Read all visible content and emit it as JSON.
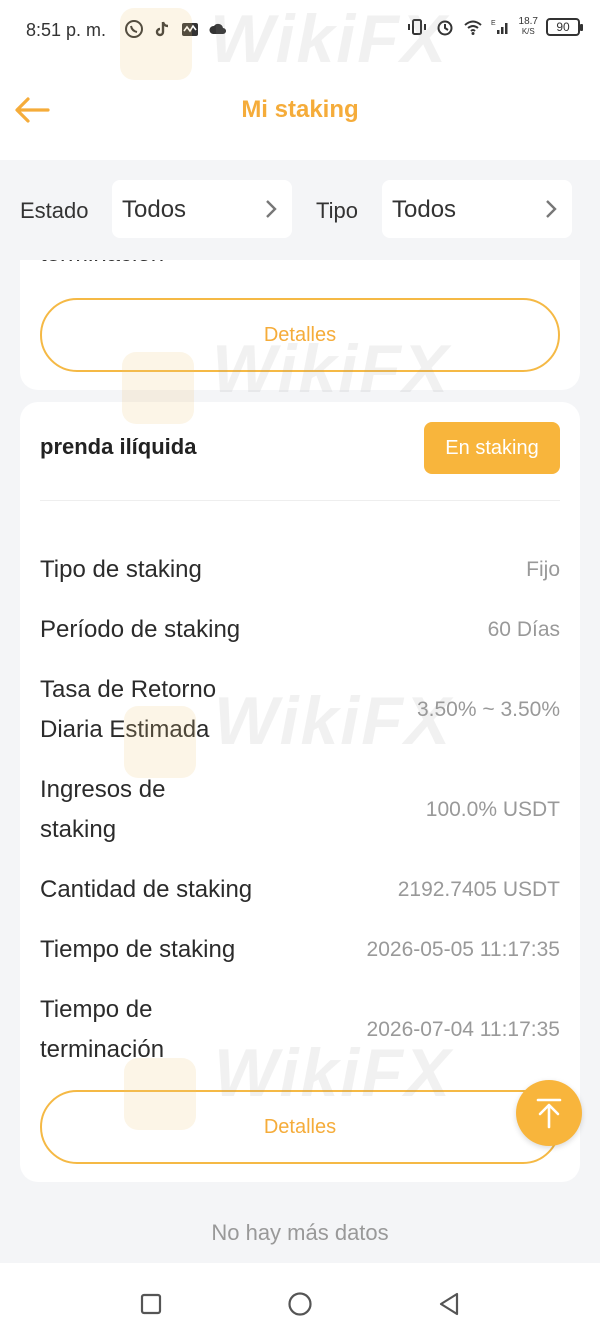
{
  "status_bar": {
    "time": "8:51 p. m.",
    "net_speed_value": "18.7",
    "net_speed_unit": "K/S",
    "battery": "90"
  },
  "header": {
    "title": "Mi staking",
    "back_icon": "arrow-left-icon"
  },
  "filters": {
    "estado_label": "Estado",
    "estado_value": "Todos",
    "tipo_label": "Tipo",
    "tipo_value": "Todos"
  },
  "card_partial": {
    "label_fragment": "terminación",
    "details_button": "Detalles"
  },
  "card": {
    "title": "prenda ilíquida",
    "status_badge": "En staking",
    "rows": [
      {
        "label": "Tipo de staking",
        "value": "Fijo"
      },
      {
        "label": "Período de staking",
        "value": "60 Días"
      },
      {
        "label": "Tasa de Retorno Diaria Estimada",
        "value": "3.50% ~ 3.50%"
      },
      {
        "label": "Ingresos de staking",
        "value": "100.0% USDT"
      },
      {
        "label": "Cantidad de staking",
        "value": "2192.7405 USDT"
      },
      {
        "label": "Tiempo de staking",
        "value": "2026-05-05 11:17:35"
      },
      {
        "label": "Tiempo de terminación",
        "value": "2026-07-04 11:17:35"
      }
    ],
    "details_button": "Detalles"
  },
  "footer_text": "No hay más datos",
  "watermark": "WikiFX",
  "colors": {
    "accent": "#f5ac3a",
    "badge_bg": "#f8b53c",
    "page_bg": "#f4f5f7",
    "muted_text": "#999999"
  }
}
